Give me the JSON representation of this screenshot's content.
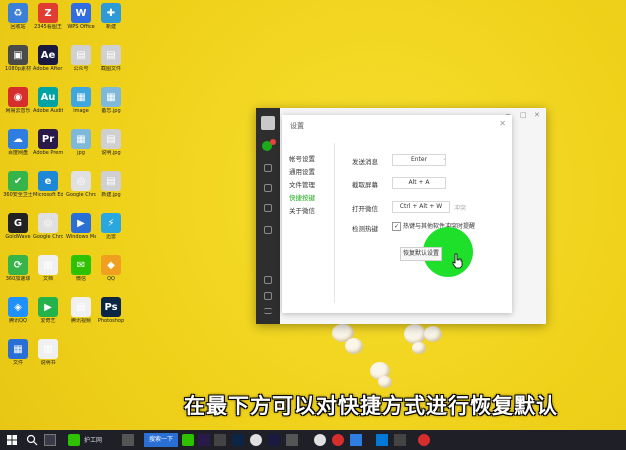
{
  "desktop_icons": [
    {
      "label": "回收站",
      "color": "#3b7fd9",
      "glyph": "♻"
    },
    {
      "label": "2345看图王",
      "color": "#e03c31",
      "glyph": "Z"
    },
    {
      "label": "WPS Office",
      "color": "#2f6de1",
      "glyph": "W"
    },
    {
      "label": "新建",
      "color": "#2f9bd6",
      "glyph": "✚"
    },
    {
      "label": "1080p素材",
      "color": "#4a4a4a",
      "glyph": "▣"
    },
    {
      "label": "Adobe After Effects",
      "color": "#1a1a40",
      "glyph": "Ae"
    },
    {
      "label": "公众号",
      "color": "#d0d0d0",
      "glyph": "▤"
    },
    {
      "label": "截图文件",
      "color": "#d0d0d0",
      "glyph": "▤"
    },
    {
      "label": "网易云音乐",
      "color": "#d62d2d",
      "glyph": "◉"
    },
    {
      "label": "Adobe Audition",
      "color": "#00a3a3",
      "glyph": "Au"
    },
    {
      "label": "image",
      "color": "#3fa6de",
      "glyph": "▦"
    },
    {
      "label": "备忘.jpg",
      "color": "#7fb8d8",
      "glyph": "▦"
    },
    {
      "label": "百度网盘",
      "color": "#2f7de1",
      "glyph": "☁"
    },
    {
      "label": "Adobe Premiere Pro",
      "color": "#2a1a4a",
      "glyph": "Pr"
    },
    {
      "label": "jpg",
      "color": "#7fb8d8",
      "glyph": "▦"
    },
    {
      "label": "说明.jpg",
      "color": "#d0d0d0",
      "glyph": "▤"
    },
    {
      "label": "360安全卫士",
      "color": "#35b44a",
      "glyph": "✔"
    },
    {
      "label": "Microsoft Edge",
      "color": "#1e88d6",
      "glyph": "e"
    },
    {
      "label": "Google Chrome",
      "color": "#e0e0e0",
      "glyph": "◎"
    },
    {
      "label": "新建.jpg",
      "color": "#d0d0d0",
      "glyph": "▤"
    },
    {
      "label": "GoldWave",
      "color": "#222",
      "glyph": "G"
    },
    {
      "label": "Google Chrome",
      "color": "#e0e0e0",
      "glyph": "◎"
    },
    {
      "label": "Windows Media",
      "color": "#2a6fd6",
      "glyph": "▶"
    },
    {
      "label": "迅雷",
      "color": "#2ba7e0",
      "glyph": "⚡"
    },
    {
      "label": "360加速球",
      "color": "#35b44a",
      "glyph": "⟳"
    },
    {
      "label": "文档",
      "color": "#f0f0f0",
      "glyph": "▥"
    },
    {
      "label": "微信",
      "color": "#2dc100",
      "glyph": "✉"
    },
    {
      "label": "QQ",
      "color": "#f0a020",
      "glyph": "◆"
    },
    {
      "label": "腾讯QQ",
      "color": "#1e90ff",
      "glyph": "◈"
    },
    {
      "label": "爱奇艺",
      "color": "#24b24a",
      "glyph": "▶"
    },
    {
      "label": "腾讯视频",
      "color": "#f0f0f0",
      "glyph": "▤"
    },
    {
      "label": "Photoshop",
      "color": "#0b2545",
      "glyph": "Ps"
    },
    {
      "label": "文件",
      "color": "#2a6fd6",
      "glyph": "▦"
    },
    {
      "label": "说明书",
      "color": "#f0f0f0",
      "glyph": "▥"
    }
  ],
  "window": {
    "dialog_title": "设置",
    "close_glyph": "✕",
    "controls": [
      "─",
      "□",
      "✕"
    ],
    "menu": [
      {
        "label": "帐号设置",
        "active": false
      },
      {
        "label": "通用设置",
        "active": false
      },
      {
        "label": "文件管理",
        "active": false
      },
      {
        "label": "快捷按键",
        "active": true
      },
      {
        "label": "关于微信",
        "active": false
      }
    ],
    "shortcuts": [
      {
        "label": "发送消息",
        "value": "Enter",
        "hint": ""
      },
      {
        "label": "截取屏幕",
        "value": "Alt + A",
        "hint": ""
      },
      {
        "label": "打开微信",
        "value": "Ctrl + Alt + W",
        "hint": "冲突"
      },
      {
        "label": "检测热键",
        "value": "",
        "hint": ""
      }
    ],
    "checkbox_text": "热键与其他软件冲突时提醒",
    "reset_button": "恢复默认设置"
  },
  "subtitle": "在最下方可以对快捷方式进行恢复默认",
  "taskbar": {
    "app_label": "护工网",
    "search_label": "搜索一下"
  }
}
